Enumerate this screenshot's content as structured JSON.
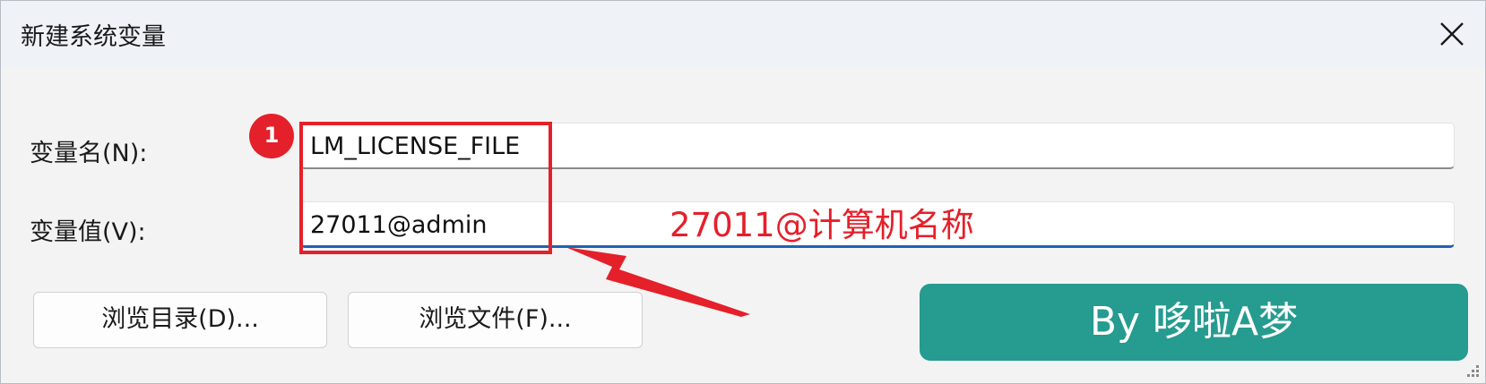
{
  "dialog": {
    "title": "新建系统变量",
    "close_icon": "close-icon"
  },
  "form": {
    "name_label": "变量名(N):",
    "name_value": "LM_LICENSE_FILE",
    "value_label": "变量值(V):",
    "value_value": "27011@admin"
  },
  "buttons": {
    "browse_dir": "浏览目录(D)...",
    "browse_file": "浏览文件(F)..."
  },
  "annotations": {
    "step_number": "1",
    "hint": "27011@计算机名称",
    "color": "#e4202a"
  },
  "watermark": {
    "text": "By 哆啦A梦",
    "color": "#269b8f"
  },
  "colors": {
    "titlebar": "#eff3f8",
    "focus_underline": "#1e62b4"
  }
}
